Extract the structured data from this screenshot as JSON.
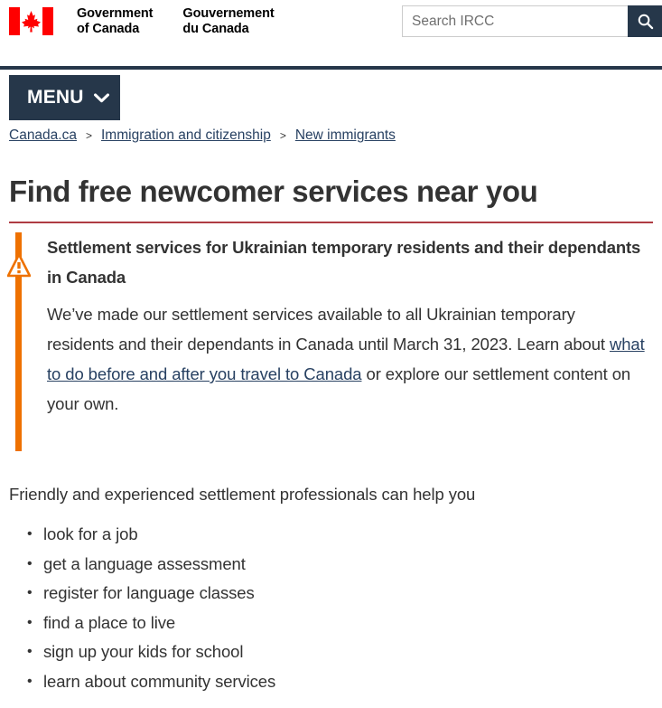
{
  "header": {
    "flag_icon": "canada-flag-icon",
    "brand_en_line1": "Government",
    "brand_en_line2": "of Canada",
    "brand_fr_line1": "Gouvernement",
    "brand_fr_line2": "du Canada",
    "search": {
      "placeholder": "Search IRCC",
      "value": "",
      "button_icon": "search-icon",
      "button_label": "Search"
    }
  },
  "menu": {
    "label": "MENU",
    "caret_icon": "chevron-down-icon"
  },
  "breadcrumb": {
    "separator": ">",
    "items": [
      {
        "label": "Canada.ca"
      },
      {
        "label": "Immigration and citizenship"
      },
      {
        "label": "New immigrants"
      }
    ]
  },
  "page": {
    "title": "Find free newcomer services near you"
  },
  "alert": {
    "icon": "warning-triangle-icon",
    "title": "Settlement services for Ukrainian temporary residents and their dependants in Canada",
    "body_before_link": "We’ve made our settlement services available to all Ukrainian temporary residents and their dependants in Canada until March 31, 2023. Learn about ",
    "link_text": "what to do before and after you travel to Canada",
    "body_after_link": " or explore our settlement content on your own."
  },
  "content": {
    "intro": "Friendly and experienced settlement professionals can help you",
    "help_items": [
      "look for a job",
      "get a language assessment",
      "register for language classes",
      "find a place to live",
      "sign up your kids for school",
      "learn about community services"
    ]
  },
  "colors": {
    "brand_navy": "#26374A",
    "link_blue": "#284162",
    "accent_red": "#AF3C43",
    "alert_orange": "#EE7100",
    "flag_red": "#FF0000",
    "text": "#333333"
  }
}
